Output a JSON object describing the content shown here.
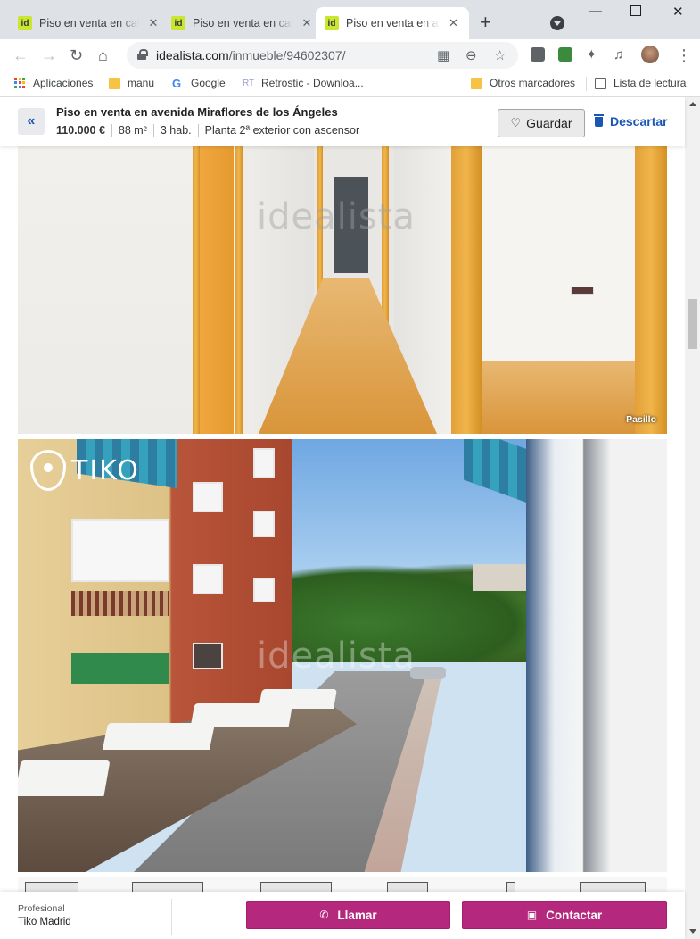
{
  "browser": {
    "tabs": [
      {
        "favicon": "id",
        "title": "Piso en venta en calle"
      },
      {
        "favicon": "id",
        "title": "Piso en venta en calle"
      },
      {
        "favicon": "id",
        "title": "Piso en venta en avenida"
      }
    ],
    "active_tab": 2,
    "url_host": "idealista.com",
    "url_path": "/inmueble/94602307/",
    "bookmarks": [
      {
        "icon": "apps-grid-icon",
        "label": "Aplicaciones"
      },
      {
        "icon": "folder-icon",
        "label": "manu"
      },
      {
        "icon": "google-icon",
        "label": "Google"
      },
      {
        "icon": "retrostic-icon",
        "label": "Retrostic - Downloa..."
      }
    ],
    "bookmarks_right": [
      {
        "icon": "folder-icon",
        "label": "Otros marcadores"
      },
      {
        "icon": "reading-list-icon",
        "label": "Lista de lectura"
      }
    ]
  },
  "listing": {
    "title": "Piso en venta en avenida Miraflores de los Ángeles",
    "price": "110.000 €",
    "size": "88 m²",
    "rooms": "3 hab.",
    "floor": "Planta 2ª exterior con ascensor",
    "save_label": "Guardar",
    "discard_label": "Descartar"
  },
  "gallery": {
    "watermark": "idealista",
    "photo1_caption": "Pasillo",
    "photo2_logo": "TIKO"
  },
  "contact": {
    "advertiser_type": "Profesional",
    "advertiser_name": "Tiko Madrid",
    "call_label": "Llamar",
    "contact_label": "Contactar"
  },
  "colors": {
    "accent_blue": "#1a57b5",
    "cta_magenta": "#b4297d",
    "favicon_green": "#cbe630"
  }
}
